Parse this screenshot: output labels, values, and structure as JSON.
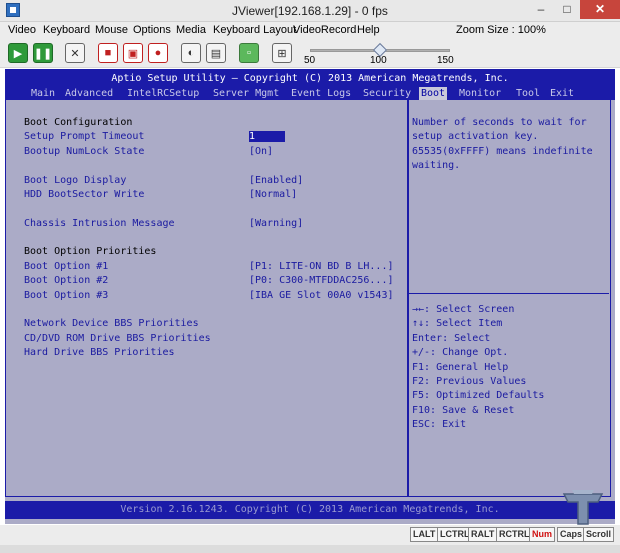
{
  "window": {
    "title": "JViewer[192.168.1.29] - 0 fps",
    "minimize": "–",
    "maximize": "□",
    "close": "✕"
  },
  "menubar": {
    "items": [
      "Video",
      "Keyboard",
      "Mouse",
      "Options",
      "Media",
      "Keyboard Layout",
      "VideoRecord",
      "Help"
    ],
    "zoom": "Zoom Size : 100%"
  },
  "toolbar": {
    "icons": [
      "play-icon",
      "pause-icon",
      "fullscreen-icon",
      "stop-record-icon",
      "save-icon",
      "disc-icon",
      "mouse-icon",
      "keyboard-icon",
      "ctrl-alt-del-icon",
      "hotkeys-icon"
    ],
    "zoom_slider": {
      "min_label": "50",
      "mid_label": "100",
      "max_label": "150",
      "value": 100
    }
  },
  "bios": {
    "title": "Aptio Setup Utility – Copyright (C) 2013 American Megatrends, Inc.",
    "tabs": [
      "Main",
      "Advanced",
      "IntelRCSetup",
      "Server Mgmt",
      "Event Logs",
      "Security",
      "Boot",
      "Monitor",
      "Tool",
      "Exit"
    ],
    "active_tab": "Boot",
    "section_title": "Boot Configuration",
    "settings": {
      "setup_prompt_timeout": {
        "label": "Setup Prompt Timeout",
        "value": "1"
      },
      "bootup_numlock": {
        "label": "Bootup NumLock State",
        "value": "[On]"
      },
      "boot_logo": {
        "label": "Boot Logo Display",
        "value": "[Enabled]"
      },
      "hdd_bootsector": {
        "label": "HDD BootSector Write",
        "value": "[Normal]"
      },
      "chassis_intrusion": {
        "label": "Chassis Intrusion Message",
        "value": "[Warning]"
      }
    },
    "priorities_title": "Boot Option Priorities",
    "boot_options": [
      {
        "label": "Boot Option #1",
        "value": "[P1: LITE-ON BD B LH...]"
      },
      {
        "label": "Boot Option #2",
        "value": "[P0: C300-MTFDDAC256...]"
      },
      {
        "label": "Boot Option #3",
        "value": "[IBA GE Slot 00A0 v1543]"
      }
    ],
    "bbs_links": [
      "Network Device BBS Priorities",
      "CD/DVD ROM Drive BBS Priorities",
      "Hard Drive BBS Priorities"
    ],
    "help_text": [
      "Number of seconds to wait for",
      "setup activation key.",
      "65535(0xFFFF) means indefinite",
      "waiting."
    ],
    "keys": [
      "→←: Select Screen",
      "↑↓: Select Item",
      "Enter: Select",
      "+/-: Change Opt.",
      "F1: General Help",
      "F2: Previous Values",
      "F5: Optimized Defaults",
      "F10: Save & Reset",
      "ESC: Exit"
    ],
    "footer": "Version 2.16.1243. Copyright (C) 2013 American Megatrends, Inc."
  },
  "statusbar": {
    "keys": [
      "LALT",
      "LCTRL",
      "RALT",
      "RCTRL",
      "Num",
      "Caps",
      "Scroll"
    ],
    "active_key": "Num"
  },
  "colors": {
    "bios_bg": "#ababc7",
    "bios_blue": "#1b1ba8",
    "text_blue": "#1a1aa0",
    "close_red": "#c7453c"
  }
}
